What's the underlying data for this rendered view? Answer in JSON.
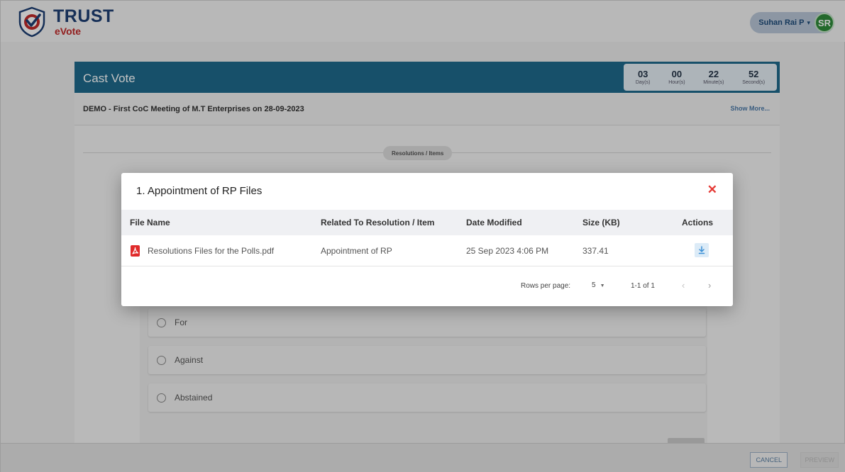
{
  "header": {
    "logo_text": "TRUST",
    "logo_subtext": "eVote",
    "user_name": "Suhan Rai P",
    "user_caret": "▾",
    "avatar_initials": "SR"
  },
  "card": {
    "title": "Cast Vote",
    "timer": [
      {
        "value": "03",
        "label": "Day(s)"
      },
      {
        "value": "00",
        "label": "Hour(s)"
      },
      {
        "value": "22",
        "label": "Minute(s)"
      },
      {
        "value": "52",
        "label": "Second(s)"
      }
    ],
    "meeting_title": "DEMO - First CoC Meeting of M.T Enterprises on 28-09-2023",
    "show_more": "Show More...",
    "resolutions_label": "Resolutions / Items",
    "options": [
      "For",
      "Against",
      "Abstained"
    ]
  },
  "footer": {
    "cancel": "CANCEL",
    "preview": "PREVIEW"
  },
  "modal": {
    "title": "1. Appointment of RP Files",
    "close": "✕",
    "columns": [
      "File Name",
      "Related To Resolution / Item",
      "Date Modified",
      "Size (KB)",
      "Actions"
    ],
    "rows": [
      {
        "file_name": "Resolutions Files for the Polls.pdf",
        "related": "Appointment of RP",
        "date_modified": "25 Sep 2023 4:06 PM",
        "size": "337.41",
        "file_icon": "pdf-icon",
        "action_icon": "download-icon"
      }
    ],
    "pagination": {
      "rows_per_page_label": "Rows per page:",
      "rows_per_page": "5",
      "range": "1-1 of 1",
      "prev": "‹",
      "next": "›"
    }
  },
  "colors": {
    "header_bar": "#1f6a8c",
    "logo_navy": "#1d3f73",
    "logo_red": "#c02a2a",
    "close_red": "#e53935",
    "avatar_green": "#2e8b3b",
    "pdf_red": "#e02b2b",
    "download_blue": "#3a8fd6"
  }
}
